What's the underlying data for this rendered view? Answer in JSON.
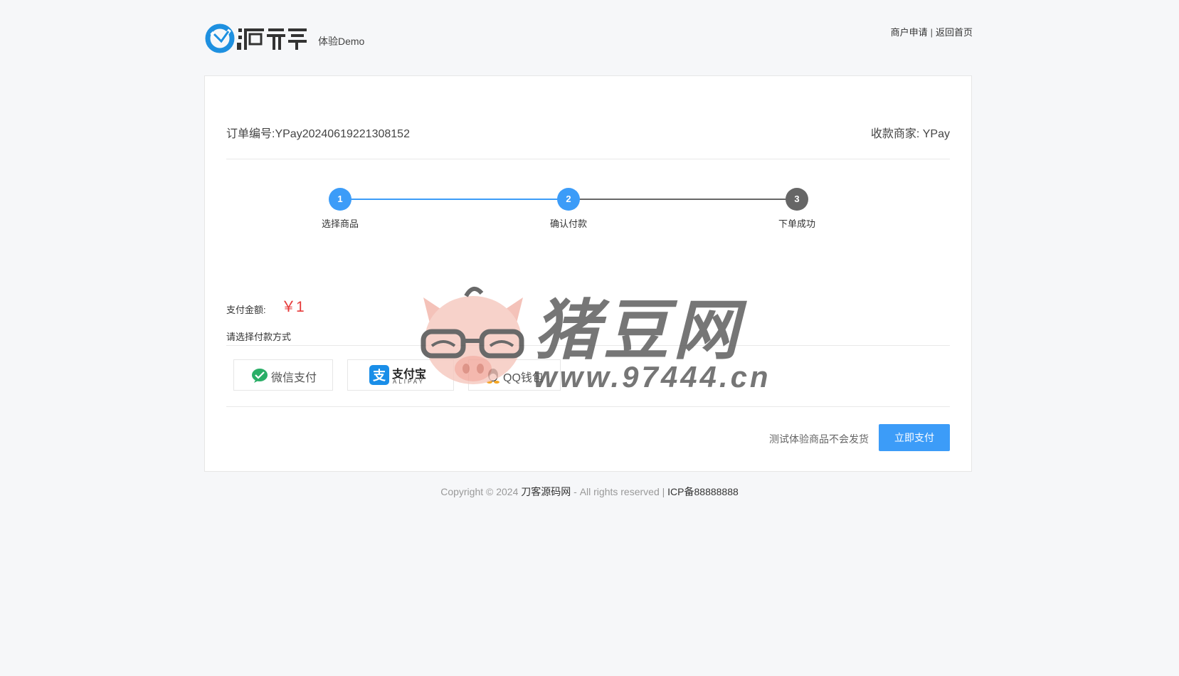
{
  "header": {
    "logo_alt": "源码",
    "subtitle": "体验Demo",
    "links": [
      "商户申请",
      "返回首页"
    ],
    "separator": "|"
  },
  "order": {
    "id_text": "订单编号:YPay20240619221308152",
    "merchant_text": "收款商家: YPay"
  },
  "steps": [
    {
      "number": "1",
      "label": "选择商品",
      "state": "done"
    },
    {
      "number": "2",
      "label": "确认付款",
      "state": "current"
    },
    {
      "number": "3",
      "label": "下单成功",
      "state": "pending"
    }
  ],
  "payment": {
    "amount_label": "支付金额:",
    "amount_value": "￥1",
    "method_title": "请选择付款方式",
    "methods": [
      {
        "name": "微信支付",
        "icon": "wechat-pay-icon"
      },
      {
        "name": "支付宝",
        "sub": "ALIPAY",
        "icon": "alipay-icon"
      },
      {
        "name": "QQ钱包",
        "icon": "qq-wallet-icon"
      }
    ],
    "note": "测试体验商品不会发货",
    "pay_button": "立即支付"
  },
  "footer": {
    "prefix": "Copyright © 2024",
    "site": "刀客源码网",
    "middle": "- All rights reserved |",
    "icp": "ICP备88888888"
  },
  "watermark": {
    "title": "猪豆网",
    "url": "www.97444.cn"
  },
  "colors": {
    "accent": "#3c9cf8",
    "step_active": "#3c9cf8",
    "step_pending": "#666666",
    "amount": "#e63b3b",
    "wechat": "#2aae67",
    "alipay": "#1a8ee8"
  }
}
